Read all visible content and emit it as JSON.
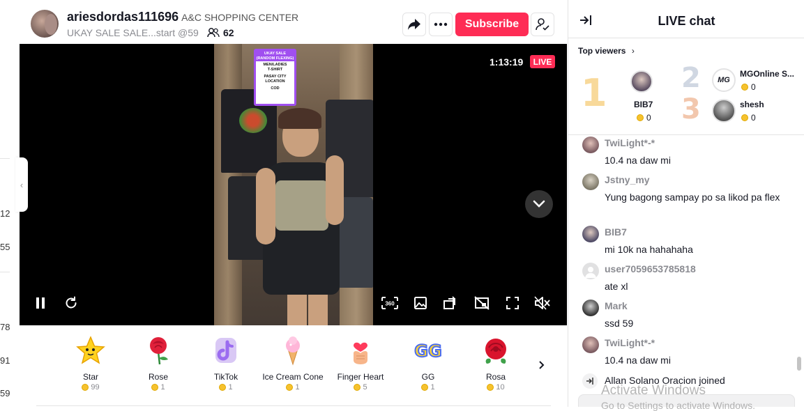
{
  "left_strip": {
    "numbers": [
      "12",
      "55",
      "78",
      "91",
      "59"
    ]
  },
  "header": {
    "username": "ariesdordas111696",
    "shop_name": "A&C SHOPPING CENTER",
    "stream_title": "UKAY SALE SALE...start @59",
    "viewer_count": "62",
    "subscribe_label": "Subscribe"
  },
  "video": {
    "timer": "1:13:19",
    "live_label": "LIVE",
    "sign": {
      "heading_1": "UKAY SALE",
      "heading_2": "(RANDOM FLEXING)",
      "line_1": "MEN/LADIES",
      "line_2": "T-SHIRT",
      "line_3": "PASAY CITY",
      "line_4": "LOCATION",
      "line_5": "COD"
    },
    "controls": {
      "pause_icon": "pause-icon",
      "refresh_icon": "refresh-icon",
      "view360_label": "360"
    }
  },
  "gifts": [
    {
      "name": "Star",
      "cost": "99",
      "icon": "star-gift-icon"
    },
    {
      "name": "Rose",
      "cost": "1",
      "icon": "rose-gift-icon"
    },
    {
      "name": "TikTok",
      "cost": "1",
      "icon": "tiktok-gift-icon"
    },
    {
      "name": "Ice Cream Cone",
      "cost": "1",
      "icon": "ice-cream-gift-icon"
    },
    {
      "name": "Finger Heart",
      "cost": "5",
      "icon": "finger-heart-gift-icon"
    },
    {
      "name": "GG",
      "cost": "1",
      "icon": "gg-gift-icon"
    },
    {
      "name": "Rosa",
      "cost": "10",
      "icon": "rosa-gift-icon"
    }
  ],
  "chat": {
    "title": "LIVE chat",
    "top_viewers_label": "Top viewers",
    "top_viewers": [
      {
        "rank": "1",
        "name": "BIB7",
        "coins": "0"
      },
      {
        "rank": "2",
        "name": "MGOnline S...",
        "coins": "0",
        "avatar_text": "MG"
      },
      {
        "rank": "3",
        "name": "shesh",
        "coins": "0"
      }
    ],
    "messages": [
      {
        "user": "TwiLight*-*",
        "text": "10.4 na daw mi"
      },
      {
        "user": "Jstny_my",
        "text": "Yung bagong sampay po sa likod pa flex"
      },
      {
        "user": "BIB7",
        "text": "mi 10k na hahahaha"
      },
      {
        "user": "user7059653785818",
        "text": "ate xl"
      },
      {
        "user": "Mark",
        "text": "ssd 59"
      },
      {
        "user": "TwiLight*-*",
        "text": "10.4 na daw mi"
      }
    ],
    "join_text": "Allan Solano Oracion joined"
  },
  "watermark": {
    "line1": "Activate Windows",
    "line2": "Go to Settings to activate Windows."
  },
  "colors": {
    "accent": "#fe2c55",
    "sign_purple": "#a04ff0",
    "coin": "#f6c22e"
  }
}
